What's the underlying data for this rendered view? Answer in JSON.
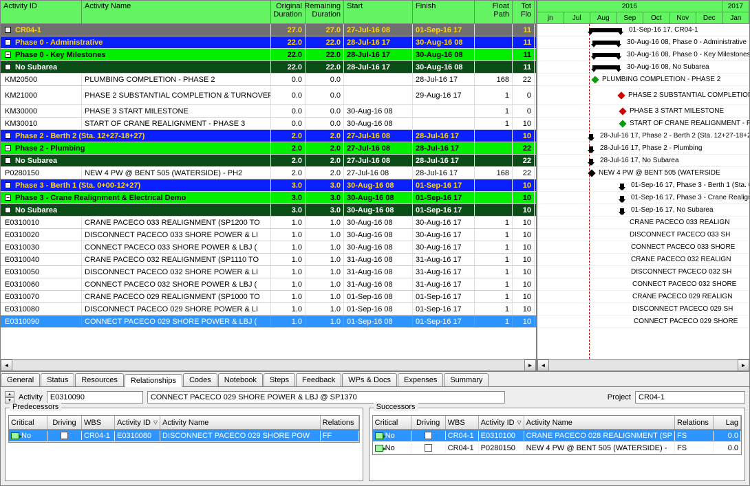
{
  "columns": {
    "aid": "Activity ID",
    "name": "Activity Name",
    "od": "Original Duration",
    "rd": "Remaining Duration",
    "start": "Start",
    "finish": "Finish",
    "fp": "Float Path",
    "tf": "Tot Flo"
  },
  "gantt_header": {
    "years": [
      "2016",
      "2017"
    ],
    "months": [
      "jn",
      "Jul",
      "Aug",
      "Sep",
      "Oct",
      "Nov",
      "Dec",
      "Jan"
    ]
  },
  "rows": [
    {
      "type": "top",
      "id": "CR04-1",
      "name": "",
      "od": "27.0",
      "rd": "27.0",
      "st": "27-Jul-16 08",
      "fn": "01-Sep-16 17",
      "fp": "",
      "tf": "11",
      "glabel": "01-Sep-16 17, CR04-1",
      "gx": 75,
      "gw": 48,
      "band": 1
    },
    {
      "type": "blue",
      "id": "Phase 0 - Administrative",
      "name": "",
      "od": "22.0",
      "rd": "22.0",
      "st": "28-Jul-16 17",
      "fn": "30-Aug-16 08",
      "fp": "",
      "tf": "11",
      "glabel": "30-Aug-16 08, Phase 0 - Administrative",
      "gx": 80,
      "gw": 40,
      "band": 1,
      "ind": "ind0"
    },
    {
      "type": "green",
      "id": "Phase 0 - Key Milestones",
      "name": "",
      "od": "22.0",
      "rd": "22.0",
      "st": "28-Jul-16 17",
      "fn": "30-Aug-16 08",
      "fp": "",
      "tf": "11",
      "glabel": "30-Aug-16 08, Phase 0 - Key Milestones",
      "gx": 80,
      "gw": 40,
      "band": 1,
      "ind": "ind1"
    },
    {
      "type": "dark",
      "id": "No Subarea",
      "name": "",
      "od": "22.0",
      "rd": "22.0",
      "st": "28-Jul-16 17",
      "fn": "30-Aug-16 08",
      "fp": "",
      "tf": "11",
      "glabel": "30-Aug-16 08, No Subarea",
      "gx": 80,
      "gw": 40,
      "band": 1,
      "ind": "ind2"
    },
    {
      "type": "act",
      "id": "KM20500",
      "name": "PLUMBING COMPLETION - PHASE 2",
      "od": "0.0",
      "rd": "0.0",
      "st": "",
      "fn": "28-Jul-16 17",
      "fp": "168",
      "tf": "22",
      "glabel": "PLUMBING COMPLETION - PHASE 2",
      "gx": 80,
      "diamond": 1,
      "dcolor": "#0c9b0c",
      "ind": "ind3"
    },
    {
      "type": "act",
      "id": "KM21000",
      "name": "PHASE 2 SUBSTANTIAL COMPLETION & TURNOVER",
      "od": "0.0",
      "rd": "0.0",
      "st": "",
      "fn": "29-Aug-16 17",
      "fp": "1",
      "tf": "0",
      "glabel": "PHASE 2 SUBSTANTIAL COMPLETION",
      "gx": 118,
      "diamond": 1,
      "dcolor": "#d00000",
      "ind": "ind3",
      "tall": 1
    },
    {
      "type": "act",
      "id": "KM30000",
      "name": "PHASE 3 START MILESTONE",
      "od": "0.0",
      "rd": "0.0",
      "st": "30-Aug-16 08",
      "fn": "",
      "fp": "1",
      "tf": "0",
      "glabel": "PHASE 3 START MILESTONE",
      "gx": 120,
      "diamond": 1,
      "dcolor": "#d00000",
      "ind": "ind3"
    },
    {
      "type": "act",
      "id": "KM30010",
      "name": "START OF CRANE REALIGNMENT - PHASE 3",
      "od": "0.0",
      "rd": "0.0",
      "st": "30-Aug-16 08",
      "fn": "",
      "fp": "1",
      "tf": "10",
      "glabel": "START OF CRANE REALIGNMENT - P",
      "gx": 120,
      "diamond": 1,
      "dcolor": "#0c9b0c",
      "ind": "ind3"
    },
    {
      "type": "blue",
      "id": "Phase 2 - Berth 2 (Sta. 12+27-18+27)",
      "name": "",
      "od": "2.0",
      "rd": "2.0",
      "st": "27-Jul-16 08",
      "fn": "28-Jul-16 17",
      "fp": "",
      "tf": "10",
      "glabel": "28-Jul-16 17, Phase 2 - Berth 2 (Sta. 12+27-18+2",
      "gx": 75,
      "gw": 6,
      "band": 1,
      "ind": "ind0"
    },
    {
      "type": "green",
      "id": "Phase 2 - Plumbing",
      "name": "",
      "od": "2.0",
      "rd": "2.0",
      "st": "27-Jul-16 08",
      "fn": "28-Jul-16 17",
      "fp": "",
      "tf": "22",
      "glabel": "28-Jul-16 17, Phase 2 - Plumbing",
      "gx": 75,
      "gw": 6,
      "band": 1,
      "ind": "ind1"
    },
    {
      "type": "dark",
      "id": "No Subarea",
      "name": "",
      "od": "2.0",
      "rd": "2.0",
      "st": "27-Jul-16 08",
      "fn": "28-Jul-16 17",
      "fp": "",
      "tf": "22",
      "glabel": "28-Jul-16 17, No Subarea",
      "gx": 75,
      "gw": 6,
      "band": 1,
      "ind": "ind2"
    },
    {
      "type": "act",
      "id": "P0280150",
      "name": "NEW 4 PW @ BENT 505 (WATERSIDE) - PH2",
      "od": "2.0",
      "rd": "2.0",
      "st": "27-Jul-16 08",
      "fn": "28-Jul-16 17",
      "fp": "168",
      "tf": "22",
      "glabel": "NEW 4 PW @ BENT 505 (WATERSIDE",
      "gx": 75,
      "diamond": 1,
      "ind": "ind3"
    },
    {
      "type": "blue",
      "id": "Phase 3 - Berth 1 (Sta. 0+00-12+27)",
      "name": "",
      "od": "3.0",
      "rd": "3.0",
      "st": "30-Aug-16 08",
      "fn": "01-Sep-16 17",
      "fp": "",
      "tf": "10",
      "glabel": "01-Sep-16 17, Phase 3 - Berth 1 (Sta. 0",
      "gx": 120,
      "gw": 6,
      "band": 1,
      "ind": "ind0"
    },
    {
      "type": "green",
      "id": "Phase 3 - Crane Realignment & Electrical Demo",
      "name": "",
      "od": "3.0",
      "rd": "3.0",
      "st": "30-Aug-16 08",
      "fn": "01-Sep-16 17",
      "fp": "",
      "tf": "10",
      "glabel": "01-Sep-16 17, Phase 3 - Crane Realign",
      "gx": 120,
      "gw": 6,
      "band": 1,
      "ind": "ind1"
    },
    {
      "type": "dark",
      "id": "No Subarea",
      "name": "",
      "od": "3.0",
      "rd": "3.0",
      "st": "30-Aug-16 08",
      "fn": "01-Sep-16 17",
      "fp": "",
      "tf": "10",
      "glabel": "01-Sep-16 17, No Subarea",
      "gx": 120,
      "gw": 6,
      "band": 1,
      "ind": "ind2"
    },
    {
      "type": "act",
      "id": "E0310010",
      "name": "CRANE PACECO 033 REALIGNMENT (SP1200 TO",
      "od": "1.0",
      "rd": "1.0",
      "st": "30-Aug-16 08",
      "fn": "30-Aug-16 17",
      "fp": "1",
      "tf": "10",
      "glabel": "CRANE PACECO 033 REALIGN",
      "gx": 120,
      "ind": "ind3"
    },
    {
      "type": "act",
      "id": "E0310020",
      "name": "DISCONNECT PACECO 033 SHORE POWER & LI",
      "od": "1.0",
      "rd": "1.0",
      "st": "30-Aug-16 08",
      "fn": "30-Aug-16 17",
      "fp": "1",
      "tf": "10",
      "glabel": "DISCONNECT PACECO 033 SH",
      "gx": 120,
      "ind": "ind3"
    },
    {
      "type": "act",
      "id": "E0310030",
      "name": "CONNECT PACECO 033 SHORE POWER & LBJ (",
      "od": "1.0",
      "rd": "1.0",
      "st": "30-Aug-16 08",
      "fn": "30-Aug-16 17",
      "fp": "1",
      "tf": "10",
      "glabel": "CONNECT PACECO 033 SHORE",
      "gx": 122,
      "ind": "ind3"
    },
    {
      "type": "act",
      "id": "E0310040",
      "name": "CRANE PACECO 032 REALIGNMENT (SP1110 TO",
      "od": "1.0",
      "rd": "1.0",
      "st": "31-Aug-16 08",
      "fn": "31-Aug-16 17",
      "fp": "1",
      "tf": "10",
      "glabel": "CRANE PACECO 032 REALIGN",
      "gx": 122,
      "ind": "ind3"
    },
    {
      "type": "act",
      "id": "E0310050",
      "name": "DISCONNECT PACECO 032 SHORE POWER & LI",
      "od": "1.0",
      "rd": "1.0",
      "st": "31-Aug-16 08",
      "fn": "31-Aug-16 17",
      "fp": "1",
      "tf": "10",
      "glabel": "DISCONNECT PACECO 032 SH",
      "gx": 122,
      "ind": "ind3"
    },
    {
      "type": "act",
      "id": "E0310060",
      "name": "CONNECT PACECO 032 SHORE POWER & LBJ (",
      "od": "1.0",
      "rd": "1.0",
      "st": "31-Aug-16 08",
      "fn": "31-Aug-16 17",
      "fp": "1",
      "tf": "10",
      "glabel": "CONNECT PACECO 032 SHORE",
      "gx": 124,
      "ind": "ind3"
    },
    {
      "type": "act",
      "id": "E0310070",
      "name": "CRANE PACECO 029 REALIGNMENT (SP1000 TO",
      "od": "1.0",
      "rd": "1.0",
      "st": "01-Sep-16 08",
      "fn": "01-Sep-16 17",
      "fp": "1",
      "tf": "10",
      "glabel": "CRANE PACECO 029 REALIGN",
      "gx": 124,
      "ind": "ind3"
    },
    {
      "type": "act",
      "id": "E0310080",
      "name": "DISCONNECT PACECO 029 SHORE POWER & LI",
      "od": "1.0",
      "rd": "1.0",
      "st": "01-Sep-16 08",
      "fn": "01-Sep-16 17",
      "fp": "1",
      "tf": "10",
      "glabel": "DISCONNECT PACECO 029 SH",
      "gx": 124,
      "ind": "ind3"
    },
    {
      "type": "act",
      "id": "E0310090",
      "name": "CONNECT PACECO 029 SHORE POWER & LBJ (",
      "od": "1.0",
      "rd": "1.0",
      "st": "01-Sep-16 08",
      "fn": "01-Sep-16 17",
      "fp": "1",
      "tf": "10",
      "glabel": "CONNECT PACECO 029 SHORE",
      "gx": 126,
      "ind": "ind3",
      "sel": 1
    }
  ],
  "tabs": [
    "General",
    "Status",
    "Resources",
    "Relationships",
    "Codes",
    "Notebook",
    "Steps",
    "Feedback",
    "WPs & Docs",
    "Expenses",
    "Summary"
  ],
  "active_tab": 3,
  "detail": {
    "activity_lbl": "Activity",
    "activity_id": "E0310090",
    "activity_name": "CONNECT PACECO 029 SHORE POWER & LBJ @ SP1370",
    "project_lbl": "Project",
    "project": "CR04-1",
    "pred_title": "Predecessors",
    "succ_title": "Successors",
    "rel_cols": {
      "crit": "Critical",
      "drv": "Driving",
      "wbs": "WBS",
      "aid": "Activity ID",
      "name": "Activity Name",
      "rel": "Relations",
      "lag": "Lag"
    },
    "predecessors": [
      {
        "crit": "No",
        "drv": true,
        "wbs": "CR04-1",
        "aid": "E0310080",
        "name": "DISCONNECT PACECO 029 SHORE POW",
        "rel": "FF",
        "lag": "",
        "sel": 1
      }
    ],
    "successors": [
      {
        "crit": "No",
        "drv": true,
        "wbs": "CR04-1",
        "aid": "E0310100",
        "name": "CRANE PACECO 028 REALIGNMENT (SP",
        "rel": "FS",
        "lag": "0.0",
        "sel": 1,
        "haslag": 1
      },
      {
        "crit": "No",
        "drv": false,
        "wbs": "CR04-1",
        "aid": "P0280150",
        "name": "NEW 4 PW @ BENT 505 (WATERSIDE) -",
        "rel": "FS",
        "lag": "0.0",
        "haslag": 1
      }
    ]
  }
}
